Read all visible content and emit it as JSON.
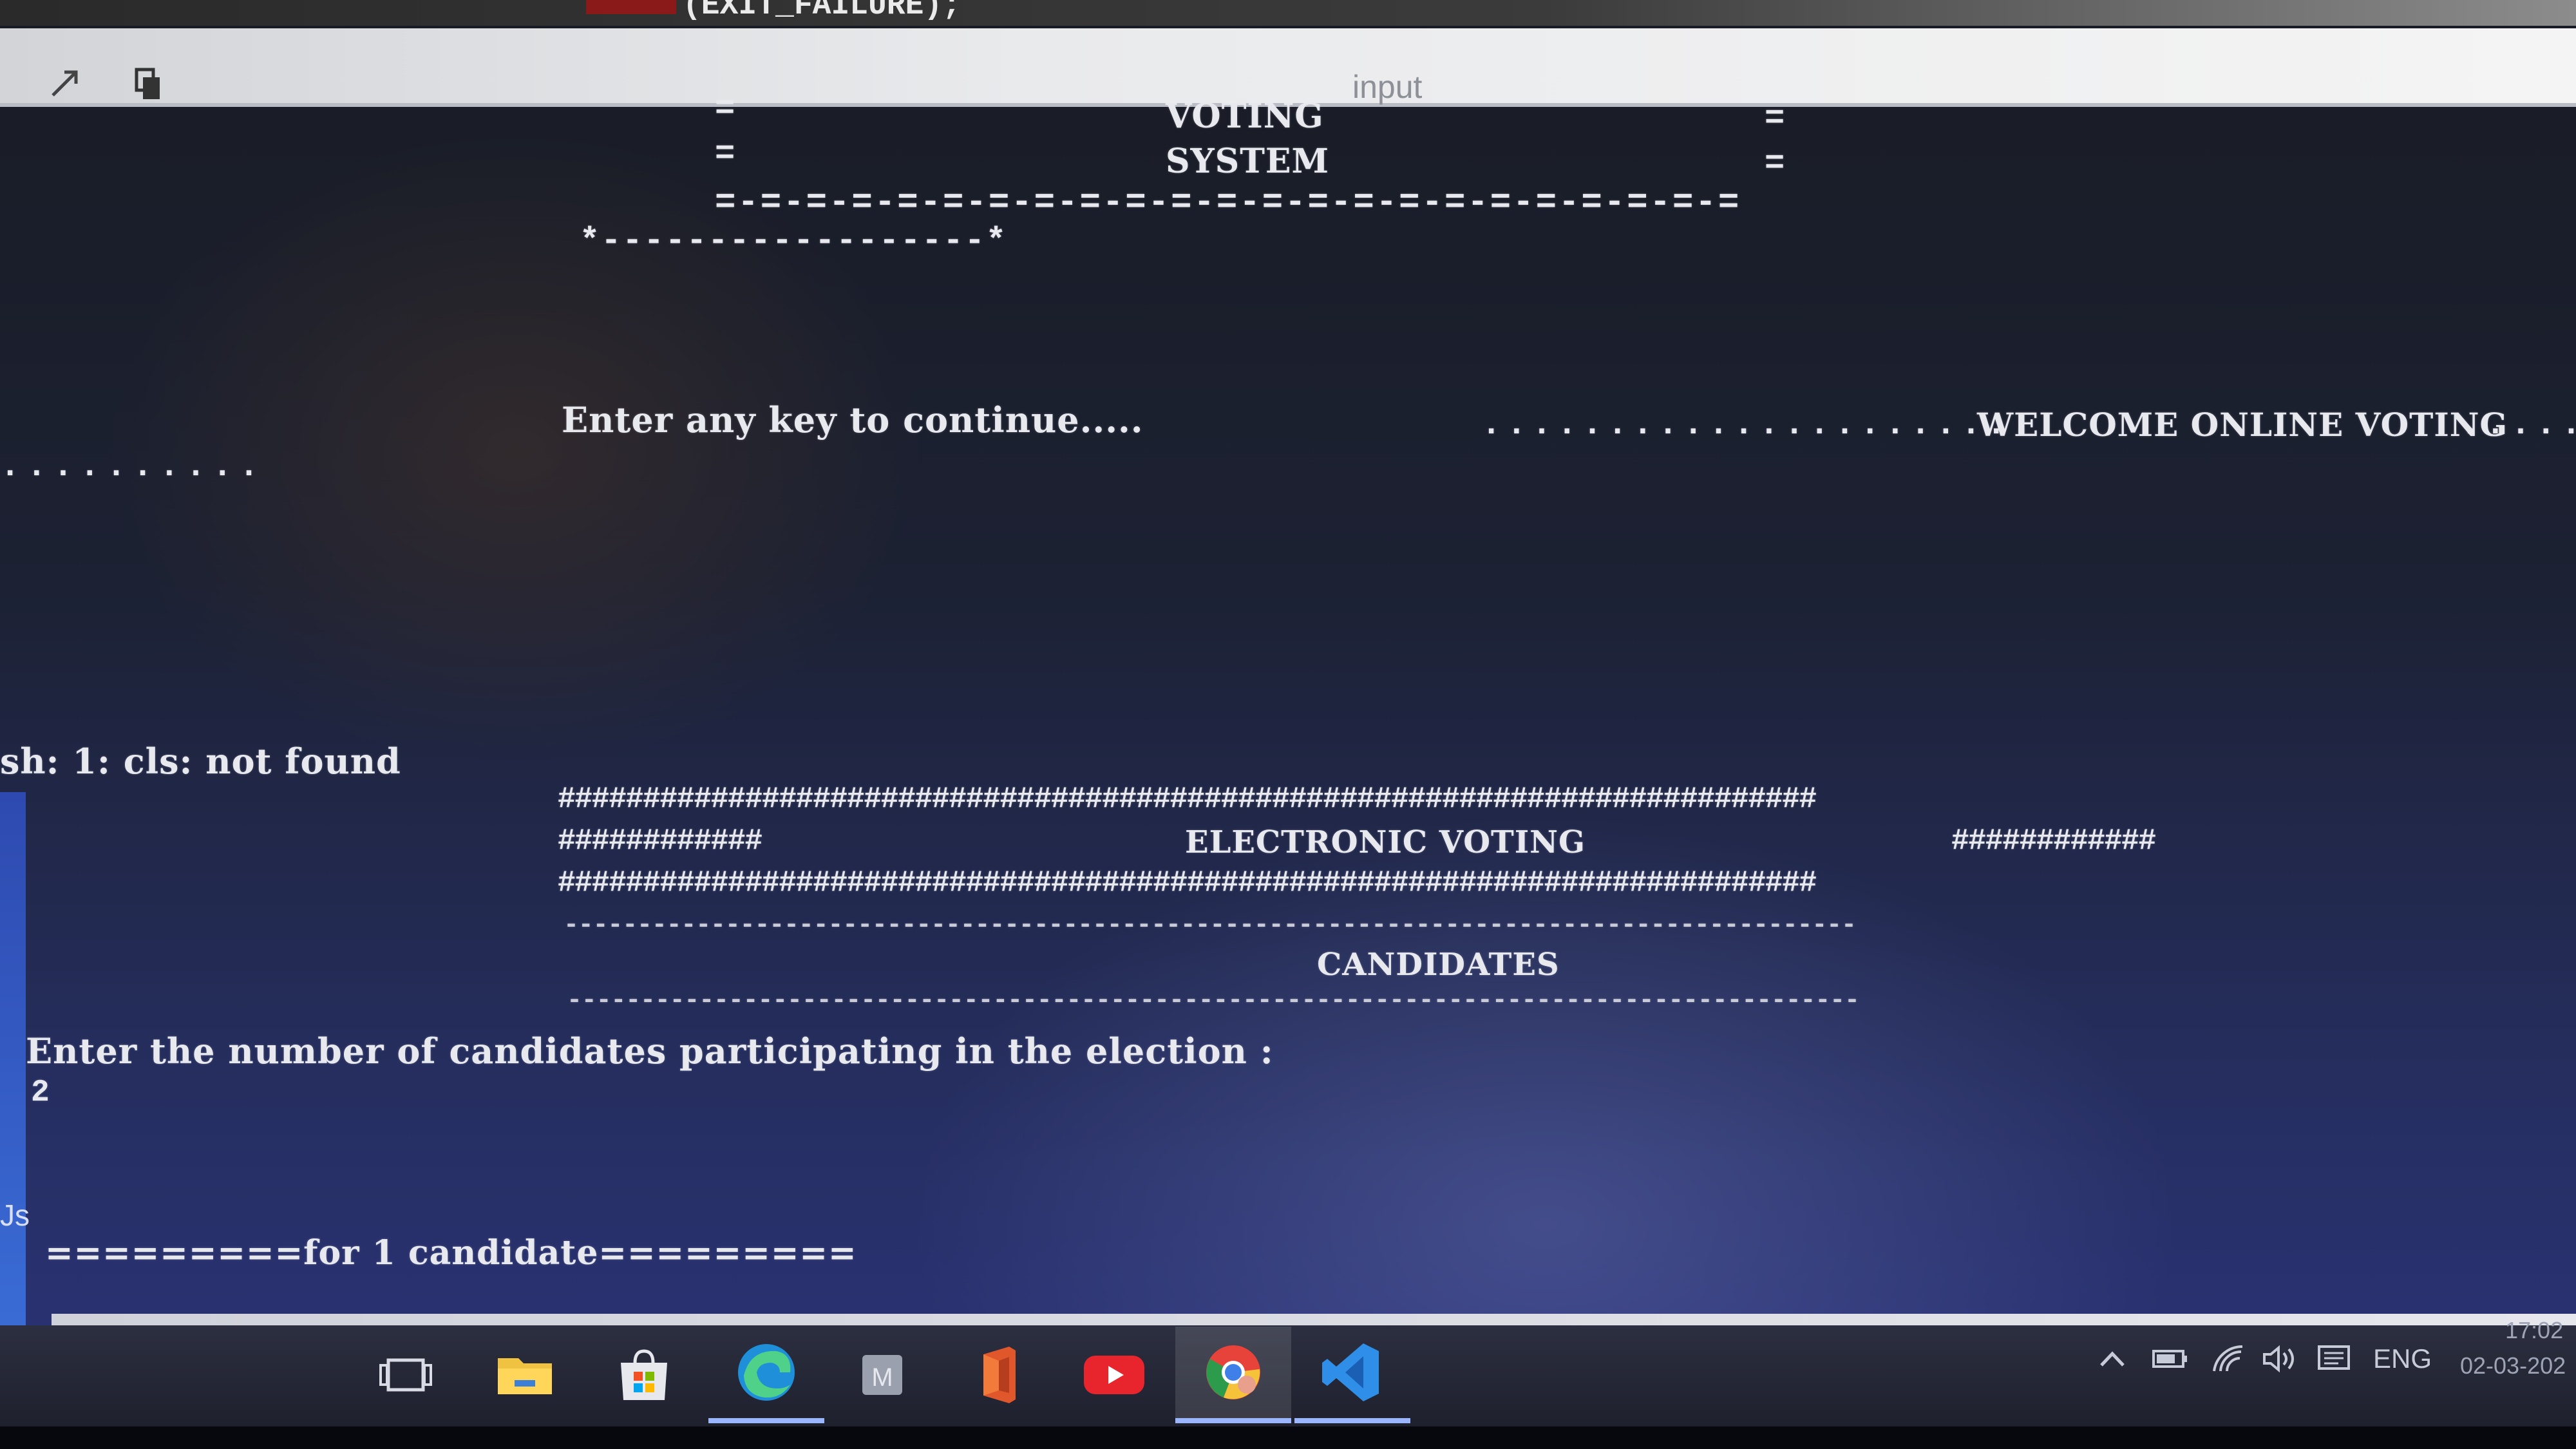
{
  "editor": {
    "top_code": "(EXIT_FAILURE);"
  },
  "input_bar": {
    "label": "input"
  },
  "terminal": {
    "header_left_eq_1": "=",
    "title_line_1": "VOTING",
    "header_right_eq_1": "=",
    "header_left_eq_2": "=",
    "title_line_2": "SYSTEM",
    "header_right_eq_2": "=",
    "header_dash_line": "=-=-=-=-=-=-=-=-=-=-=-=-=-=-=-=-=-=-=-=-=-=-=",
    "star_line": "*------------------*",
    "continue_prompt": "Enter any key to continue.....",
    "welcome_dots_left": "......................",
    "welcome_text": "WELCOME ONLINE VOTING",
    "welcome_dots_right": ".....",
    "left_dots": "..........",
    "cls_error": "sh: 1: cls: not found",
    "hash_line_1": "##########################################################################",
    "hash_side_left": "############",
    "section_title": "ELECTRONIC VOTING",
    "hash_side_right": "############",
    "hash_line_2": "##########################################################################",
    "dash_line_1": "----------------------------------------------------------------------------------------",
    "candidates_title": "CANDIDATES",
    "dash_line_2": "----------------------------------------------------------------------------------------",
    "prompt_candidates": "Enter the number of candidates participating in the election :",
    "user_input_value": "2",
    "candidate_line": "=========for 1 candidate========="
  },
  "side": {
    "left_label": "Js"
  },
  "taskbar": {
    "apps": [
      {
        "name": "task-view",
        "icon": "task-view-icon"
      },
      {
        "name": "file-explorer",
        "icon": "folder-icon"
      },
      {
        "name": "microsoft-store",
        "icon": "store-icon"
      },
      {
        "name": "edge",
        "icon": "edge-icon"
      },
      {
        "name": "mail",
        "icon": "mail-icon",
        "letter": "M"
      },
      {
        "name": "office",
        "icon": "office-icon"
      },
      {
        "name": "youtube",
        "icon": "youtube-icon"
      },
      {
        "name": "chrome",
        "icon": "chrome-icon"
      },
      {
        "name": "vscode",
        "icon": "vscode-icon"
      }
    ],
    "tray": {
      "language": "ENG",
      "time": "17:02",
      "date": "02-03-202"
    }
  },
  "colors": {
    "terminal_bg_bottom": "#2b327a",
    "terminal_text": "#e7e9ef",
    "vscode_blue": "#2f8fe8",
    "youtube_red": "#e8242c",
    "office_orange": "#e1572c"
  }
}
